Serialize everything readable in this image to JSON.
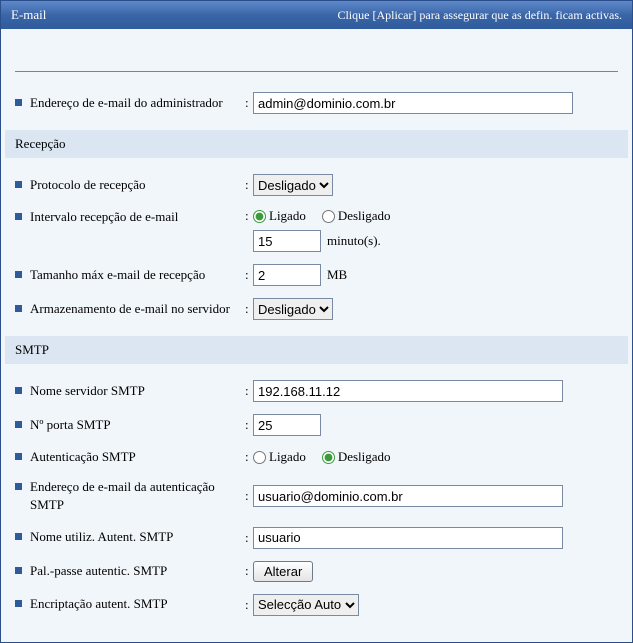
{
  "header": {
    "title": "E-mail",
    "hint": "Clique [Aplicar] para assegurar que as defin. ficam activas."
  },
  "fields": {
    "admin_email_label": "Endereço de e-mail do administrador",
    "admin_email_value": "admin@dominio.com.br"
  },
  "sections": {
    "reception": "Recepção",
    "smtp": "SMTP"
  },
  "reception": {
    "protocol_label": "Protocolo de recepção",
    "protocol_value": "Desligado",
    "interval_label": "Intervalo recepção de e-mail",
    "interval_on": "Ligado",
    "interval_off": "Desligado",
    "interval_value": "15",
    "interval_unit": "minuto(s).",
    "maxsize_label": "Tamanho máx e-mail de recepção",
    "maxsize_value": "2",
    "maxsize_unit": "MB",
    "storage_label": "Armazenamento de e-mail no servidor",
    "storage_value": "Desligado"
  },
  "smtp": {
    "server_label": "Nome servidor SMTP",
    "server_value": "192.168.11.12",
    "port_label": "Nº porta SMTP",
    "port_value": "25",
    "auth_label": "Autenticação SMTP",
    "auth_on": "Ligado",
    "auth_off": "Desligado",
    "auth_email_label": "Endereço de e-mail da autenticação SMTP",
    "auth_email_value": "usuario@dominio.com.br",
    "auth_user_label": "Nome utiliz. Autent. SMTP",
    "auth_user_value": "usuario",
    "auth_pass_label": "Pal.-passe autentic. SMTP",
    "auth_pass_button": "Alterar",
    "encrypt_label": "Encriptação autent. SMTP",
    "encrypt_value": "Selecção Auto"
  }
}
